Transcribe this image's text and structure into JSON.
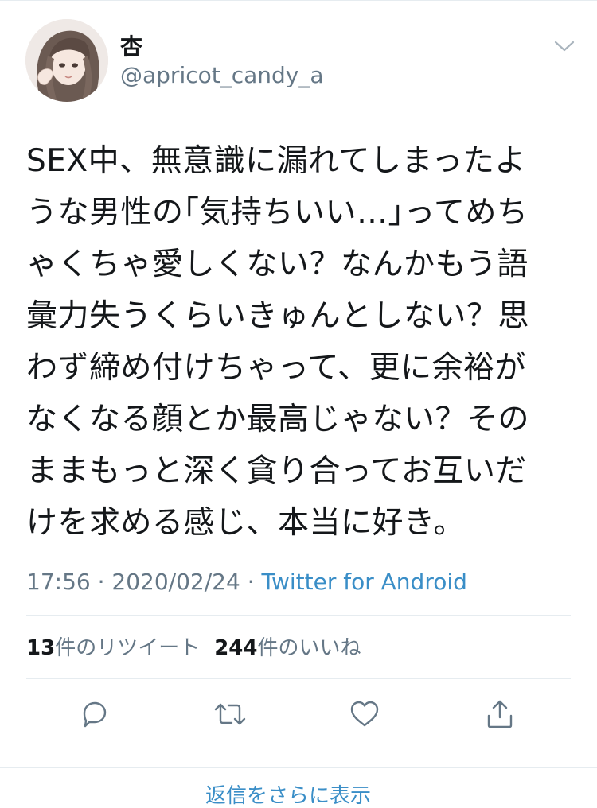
{
  "user": {
    "display_name": "杏",
    "handle": "@apricot_candy_a",
    "avatar_icon": "avatar-illustration"
  },
  "tweet": {
    "lines": [
      "SEX中、無意識に漏れてしまったよ",
      "うな男性の｢気持ちいい…｣ってめち",
      "ゃくちゃ愛しくない？なんかもう語",
      "彙力失うくらいきゅんとしない？思",
      "わず締め付けちゃって、更に余裕が",
      "なくなる顔とか最高じゃない？その",
      "ままもっと深く貪り合ってお互いだ",
      "けを求める感じ、本当に好き。"
    ],
    "time": "17:56",
    "separator": " · ",
    "date": "2020/02/24",
    "client": "Twitter for Android"
  },
  "stats": {
    "retweets_count": "13",
    "retweets_label": "件のリツイート",
    "likes_count": "244",
    "likes_label": "件のいいね"
  },
  "actions": {
    "reply_icon": "reply-icon",
    "retweet_icon": "retweet-icon",
    "like_icon": "heart-icon",
    "share_icon": "share-icon"
  },
  "footer": {
    "partial_text": "返信をさらに表示"
  },
  "colors": {
    "text_primary": "#14171a",
    "text_secondary": "#657786",
    "link": "#3a8ec7",
    "divider": "#e6ecf0"
  }
}
